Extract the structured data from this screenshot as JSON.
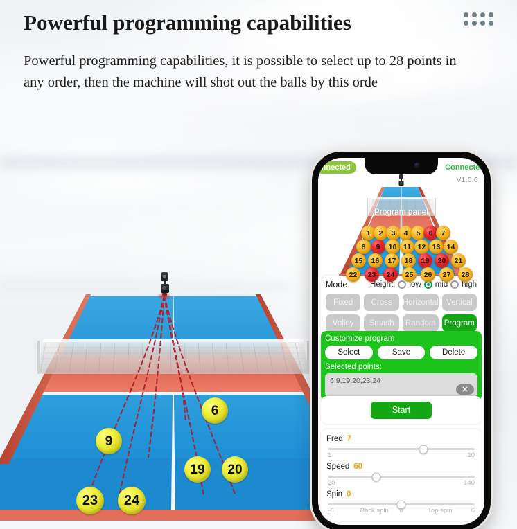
{
  "header": {
    "title": "Powerful programming capabilities",
    "subtitle": "Powerful programming capabilities, it is possible to select up to 28 points in any order, then the machine will shot out the balls by this orde",
    "dot_grid_icon": "dot-grid-icon"
  },
  "illustration": {
    "ball_labels": [
      "9",
      "23",
      "24",
      "6",
      "19",
      "20"
    ],
    "trajectory_count": 6,
    "table_color": "#2b9ede",
    "far_half_color": "#e0614f",
    "trajectory_color": "#c4202a"
  },
  "phone": {
    "status": {
      "left_badge": "Connected",
      "right_text": "Connected",
      "battery_icon": "battery-icon"
    },
    "version": "V1.0.0",
    "program_panel": {
      "label": "Program panel",
      "total_points": 28,
      "selected_points": [
        6,
        9,
        19,
        20,
        23,
        24
      ]
    },
    "mode": {
      "title": "Mode",
      "height_label": "Height:",
      "height_options": [
        "low",
        "mid",
        "high"
      ],
      "height_selected": "mid",
      "buttons": [
        "Fixed",
        "Cross",
        "Horizontal",
        "Vertical",
        "Volley",
        "Smash",
        "Random",
        "Program"
      ],
      "active_button": "Program"
    },
    "customize": {
      "title": "Customize program",
      "buttons": [
        "Select",
        "Save",
        "Delete"
      ],
      "selected_points_label": "Selected points:",
      "selected_points_value": "6,9,19,20,23,24",
      "clear_icon": "clear-icon"
    },
    "start_label": "Start",
    "sliders": [
      {
        "name": "Freq",
        "value": "7",
        "min": "1",
        "max": "10",
        "percent": 65
      },
      {
        "name": "Speed",
        "value": "60",
        "min": "20",
        "max": "140",
        "percent": 33
      },
      {
        "name": "Spin",
        "value": "0",
        "min": "-6",
        "max": "6",
        "percent": 50,
        "left_text": "Back spin",
        "mid_text": "0",
        "right_text": "Top spin"
      }
    ],
    "accent_green": "#13a813",
    "accent_amber": "#f0a500"
  }
}
